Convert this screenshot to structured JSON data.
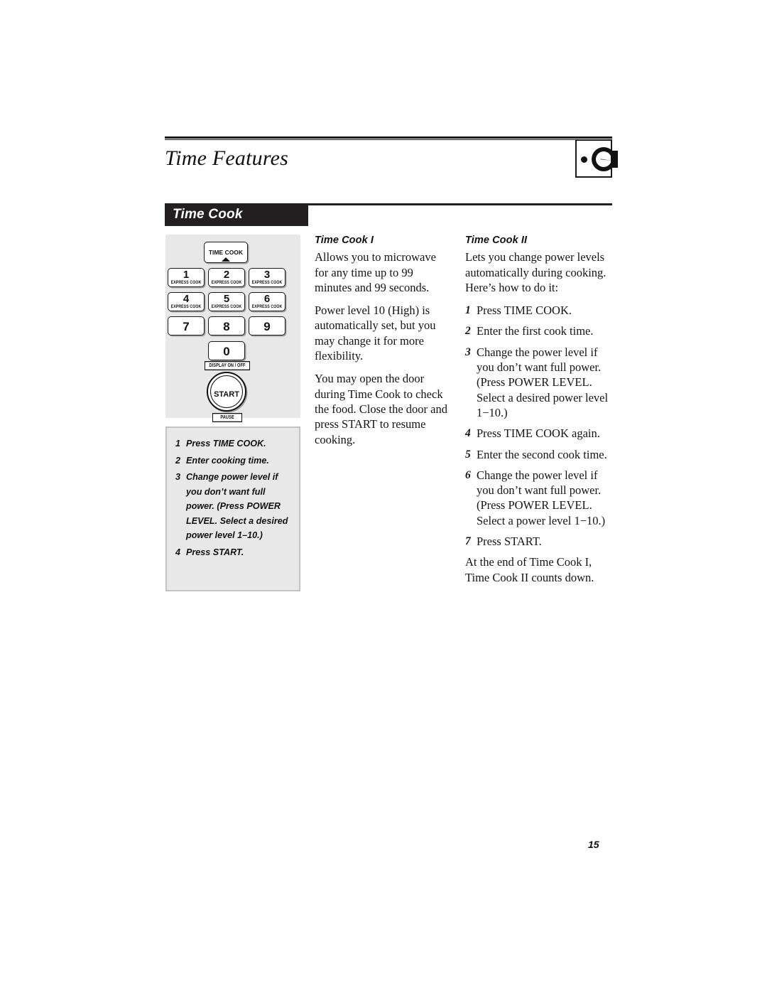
{
  "header": {
    "title": "Time Features",
    "icon_name": "dial-knob-icon",
    "bullet_name": "bullet-dot"
  },
  "section": {
    "banner_label": "Time Cook"
  },
  "keypad": {
    "time_cook_key": "TIME COOK",
    "express_cook_sub": "EXPRESS COOK",
    "keys": [
      {
        "digit": "1",
        "sub": "EXPRESS COOK"
      },
      {
        "digit": "2",
        "sub": "EXPRESS COOK"
      },
      {
        "digit": "3",
        "sub": "EXPRESS COOK"
      },
      {
        "digit": "4",
        "sub": "EXPRESS COOK"
      },
      {
        "digit": "5",
        "sub": "EXPRESS COOK"
      },
      {
        "digit": "6",
        "sub": "EXPRESS COOK"
      },
      {
        "digit": "7",
        "sub": ""
      },
      {
        "digit": "8",
        "sub": ""
      },
      {
        "digit": "9",
        "sub": ""
      },
      {
        "digit": "0",
        "sub": ""
      }
    ],
    "display_onoff_label": "DISPLAY ON / OFF",
    "start_label": "START",
    "pause_label": "PAUSE"
  },
  "steps_box": {
    "steps": [
      {
        "num": "1",
        "text": "Press TIME COOK."
      },
      {
        "num": "2",
        "text": "Enter cooking time."
      },
      {
        "num": "3",
        "text": "Change power level if you don’t want full power. (Press POWER LEVEL. Select a desired power level 1–10.)"
      },
      {
        "num": "4",
        "text": "Press START."
      }
    ]
  },
  "col_mid": {
    "heading": "Time Cook I",
    "paragraphs": [
      "Allows you to microwave for any time up to 99 minutes and 99 seconds.",
      "Power level 10 (High) is automatically set, but you may change it for more flexibility.",
      "You may open the door during Time Cook to check the food. Close the door and press START to resume cooking."
    ]
  },
  "col_right": {
    "heading": "Time Cook II",
    "intro": "Lets you change power levels automatically during cooking. Here’s how to do it:",
    "steps": [
      {
        "num": "1",
        "text": "Press TIME COOK."
      },
      {
        "num": "2",
        "text": "Enter the first cook time."
      },
      {
        "num": "3",
        "text": "Change the power level if you don’t want full power. (Press POWER LEVEL. Select a desired power level 1−10.)"
      },
      {
        "num": "4",
        "text": "Press TIME COOK again."
      },
      {
        "num": "5",
        "text": "Enter the second cook time."
      },
      {
        "num": "6",
        "text": "Change the power level if you don’t want full power. (Press POWER LEVEL. Select a power level 1−10.)"
      },
      {
        "num": "7",
        "text": "Press START."
      }
    ],
    "closing": "At the end of Time Cook I, Time Cook II counts down."
  },
  "footer": {
    "page_number": "15"
  }
}
